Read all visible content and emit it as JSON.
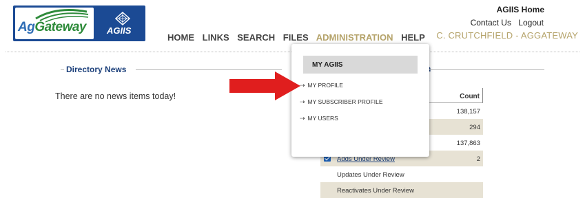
{
  "logo": {
    "brand_ag": "Ag",
    "brand_gateway": "Gateway",
    "product": "AGIIS"
  },
  "top_right": {
    "home_link": "AGIIS Home",
    "contact_link": "Contact Us",
    "logout_link": "Logout",
    "user_label": "C. CRUTCHFIELD - AGGATEWAY"
  },
  "nav": {
    "items": [
      {
        "label": "HOME",
        "active": false
      },
      {
        "label": "LINKS",
        "active": false
      },
      {
        "label": "SEARCH",
        "active": false
      },
      {
        "label": "FILES",
        "active": false
      },
      {
        "label": "ADMINISTRATION",
        "active": true
      },
      {
        "label": "HELP",
        "active": false
      }
    ]
  },
  "dropdown": {
    "header": "MY AGIIS",
    "items": [
      "MY PROFILE",
      "MY SUBSCRIBER PROFILE",
      "MY USERS"
    ]
  },
  "directory_news": {
    "title": "Directory News",
    "message": "There are no news items today!"
  },
  "right_panel": {
    "title_fragment": "n"
  },
  "table": {
    "count_header": "Count",
    "rows": [
      {
        "label": "",
        "value": "138,157",
        "shaded": false,
        "checked": false,
        "link": false
      },
      {
        "label": "",
        "value": "294",
        "shaded": true,
        "checked": false,
        "link": false
      },
      {
        "label": "",
        "value": "137,863",
        "shaded": false,
        "checked": false,
        "link": false
      },
      {
        "label": "Adds Under Review",
        "value": "2",
        "shaded": true,
        "checked": true,
        "link": true
      },
      {
        "label": "Updates Under Review",
        "value": "",
        "shaded": false,
        "checked": false,
        "link": false
      },
      {
        "label": "Reactivates Under Review",
        "value": "",
        "shaded": true,
        "checked": false,
        "link": false
      }
    ]
  },
  "colors": {
    "brand_blue": "#1b4a94",
    "nav_active": "#b5a36a",
    "heading_blue": "#1b3f7a",
    "pointer_red": "#e01e1e"
  },
  "icons": {
    "pointer": "red-arrow-icon",
    "checkbox": "checkbox-checked-icon",
    "submenu_arrow": "dashed-arrow-icon"
  }
}
